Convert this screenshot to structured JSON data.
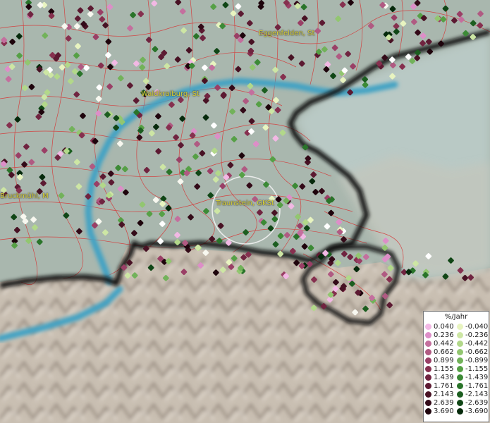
{
  "map": {
    "towns": [
      {
        "name": "Eggenfelden, St"
      },
      {
        "name": "Waldkraiburg, St"
      },
      {
        "name": "Traunstein, GKSt"
      },
      {
        "name": "Bruckmühl, M"
      }
    ],
    "colors": {
      "river": "#3fa2c4",
      "border": "#111111",
      "district_lines": "#d83030",
      "town_label": "#d9d23a",
      "lowland": "#a9b7ae",
      "alps": "#c9bfb2",
      "lake_area": "#b9c9c5"
    }
  },
  "legend": {
    "title": "%/Jahr",
    "positive": [
      {
        "value": "0.040",
        "color": "#f2b8e4"
      },
      {
        "value": "0.236",
        "color": "#dd8ec8"
      },
      {
        "value": "0.442",
        "color": "#c46f9e"
      },
      {
        "value": "0.662",
        "color": "#b05a82"
      },
      {
        "value": "0.899",
        "color": "#9a3f66"
      },
      {
        "value": "1.155",
        "color": "#86304f"
      },
      {
        "value": "1.439",
        "color": "#702440"
      },
      {
        "value": "1.761",
        "color": "#5c1a32"
      },
      {
        "value": "2.143",
        "color": "#481224"
      },
      {
        "value": "2.639",
        "color": "#330a18"
      },
      {
        "value": "3.690",
        "color": "#1e040c"
      }
    ],
    "negative": [
      {
        "value": "-0.040",
        "color": "#e8f4c0"
      },
      {
        "value": "-0.236",
        "color": "#cde6a4"
      },
      {
        "value": "-0.442",
        "color": "#b2d88a"
      },
      {
        "value": "-0.662",
        "color": "#92c670"
      },
      {
        "value": "-0.899",
        "color": "#72b25a"
      },
      {
        "value": "-1.155",
        "color": "#56a046"
      },
      {
        "value": "-1.439",
        "color": "#3c8a36"
      },
      {
        "value": "-1.761",
        "color": "#2a742a"
      },
      {
        "value": "-2.143",
        "color": "#1c5e20"
      },
      {
        "value": "-2.639",
        "color": "#104616"
      },
      {
        "value": "-3.690",
        "color": "#062a0c"
      }
    ]
  }
}
